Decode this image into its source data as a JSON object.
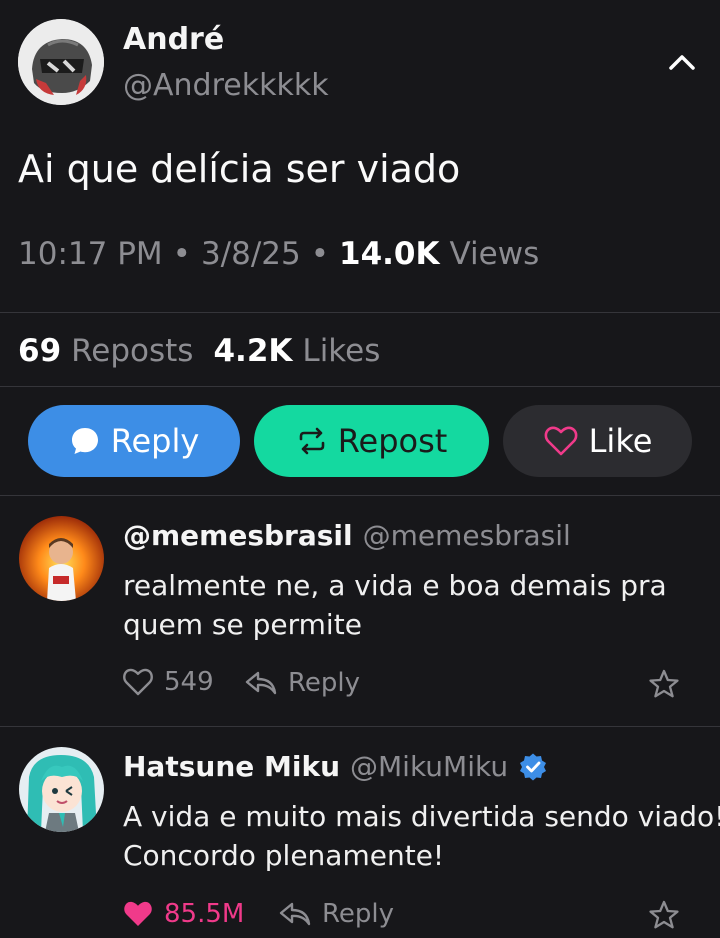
{
  "post": {
    "author_name": "André",
    "author_handle": "@Andrekkkkk",
    "text": "Ai que delícia ser viado",
    "time": "10:17 PM",
    "sep1": "•",
    "date": "3/8/25",
    "sep2": "•",
    "views_count": "14.0K",
    "views_label": "Views",
    "reposts_count": "69",
    "reposts_label": "Reposts",
    "likes_count": "4.2K",
    "likes_label": "Likes"
  },
  "actions": {
    "reply_label": "Reply",
    "repost_label": "Repost",
    "like_label": "Like"
  },
  "colors": {
    "reply": "#3d8ee6",
    "repost": "#14d9a0",
    "like_bg": "#2c2c30",
    "like_heart": "#f03a8a",
    "verified": "#3d8ee6"
  },
  "replies": [
    {
      "name": "@memesbrasil",
      "handle": "@memesbrasil",
      "text_line1": "realmente ne, a vida e boa demais pra",
      "text_line2": "quem se permite",
      "likes": "549",
      "reply_label": "Reply",
      "liked": false
    },
    {
      "name": "Hatsune Miku",
      "handle": "@MikuMiku",
      "verified": true,
      "text_line1": "A vida e muito mais divertida sendo viado!",
      "text_line2": "Concordo plenamente!",
      "likes": "85.5M",
      "reply_label": "Reply",
      "liked": true
    }
  ]
}
